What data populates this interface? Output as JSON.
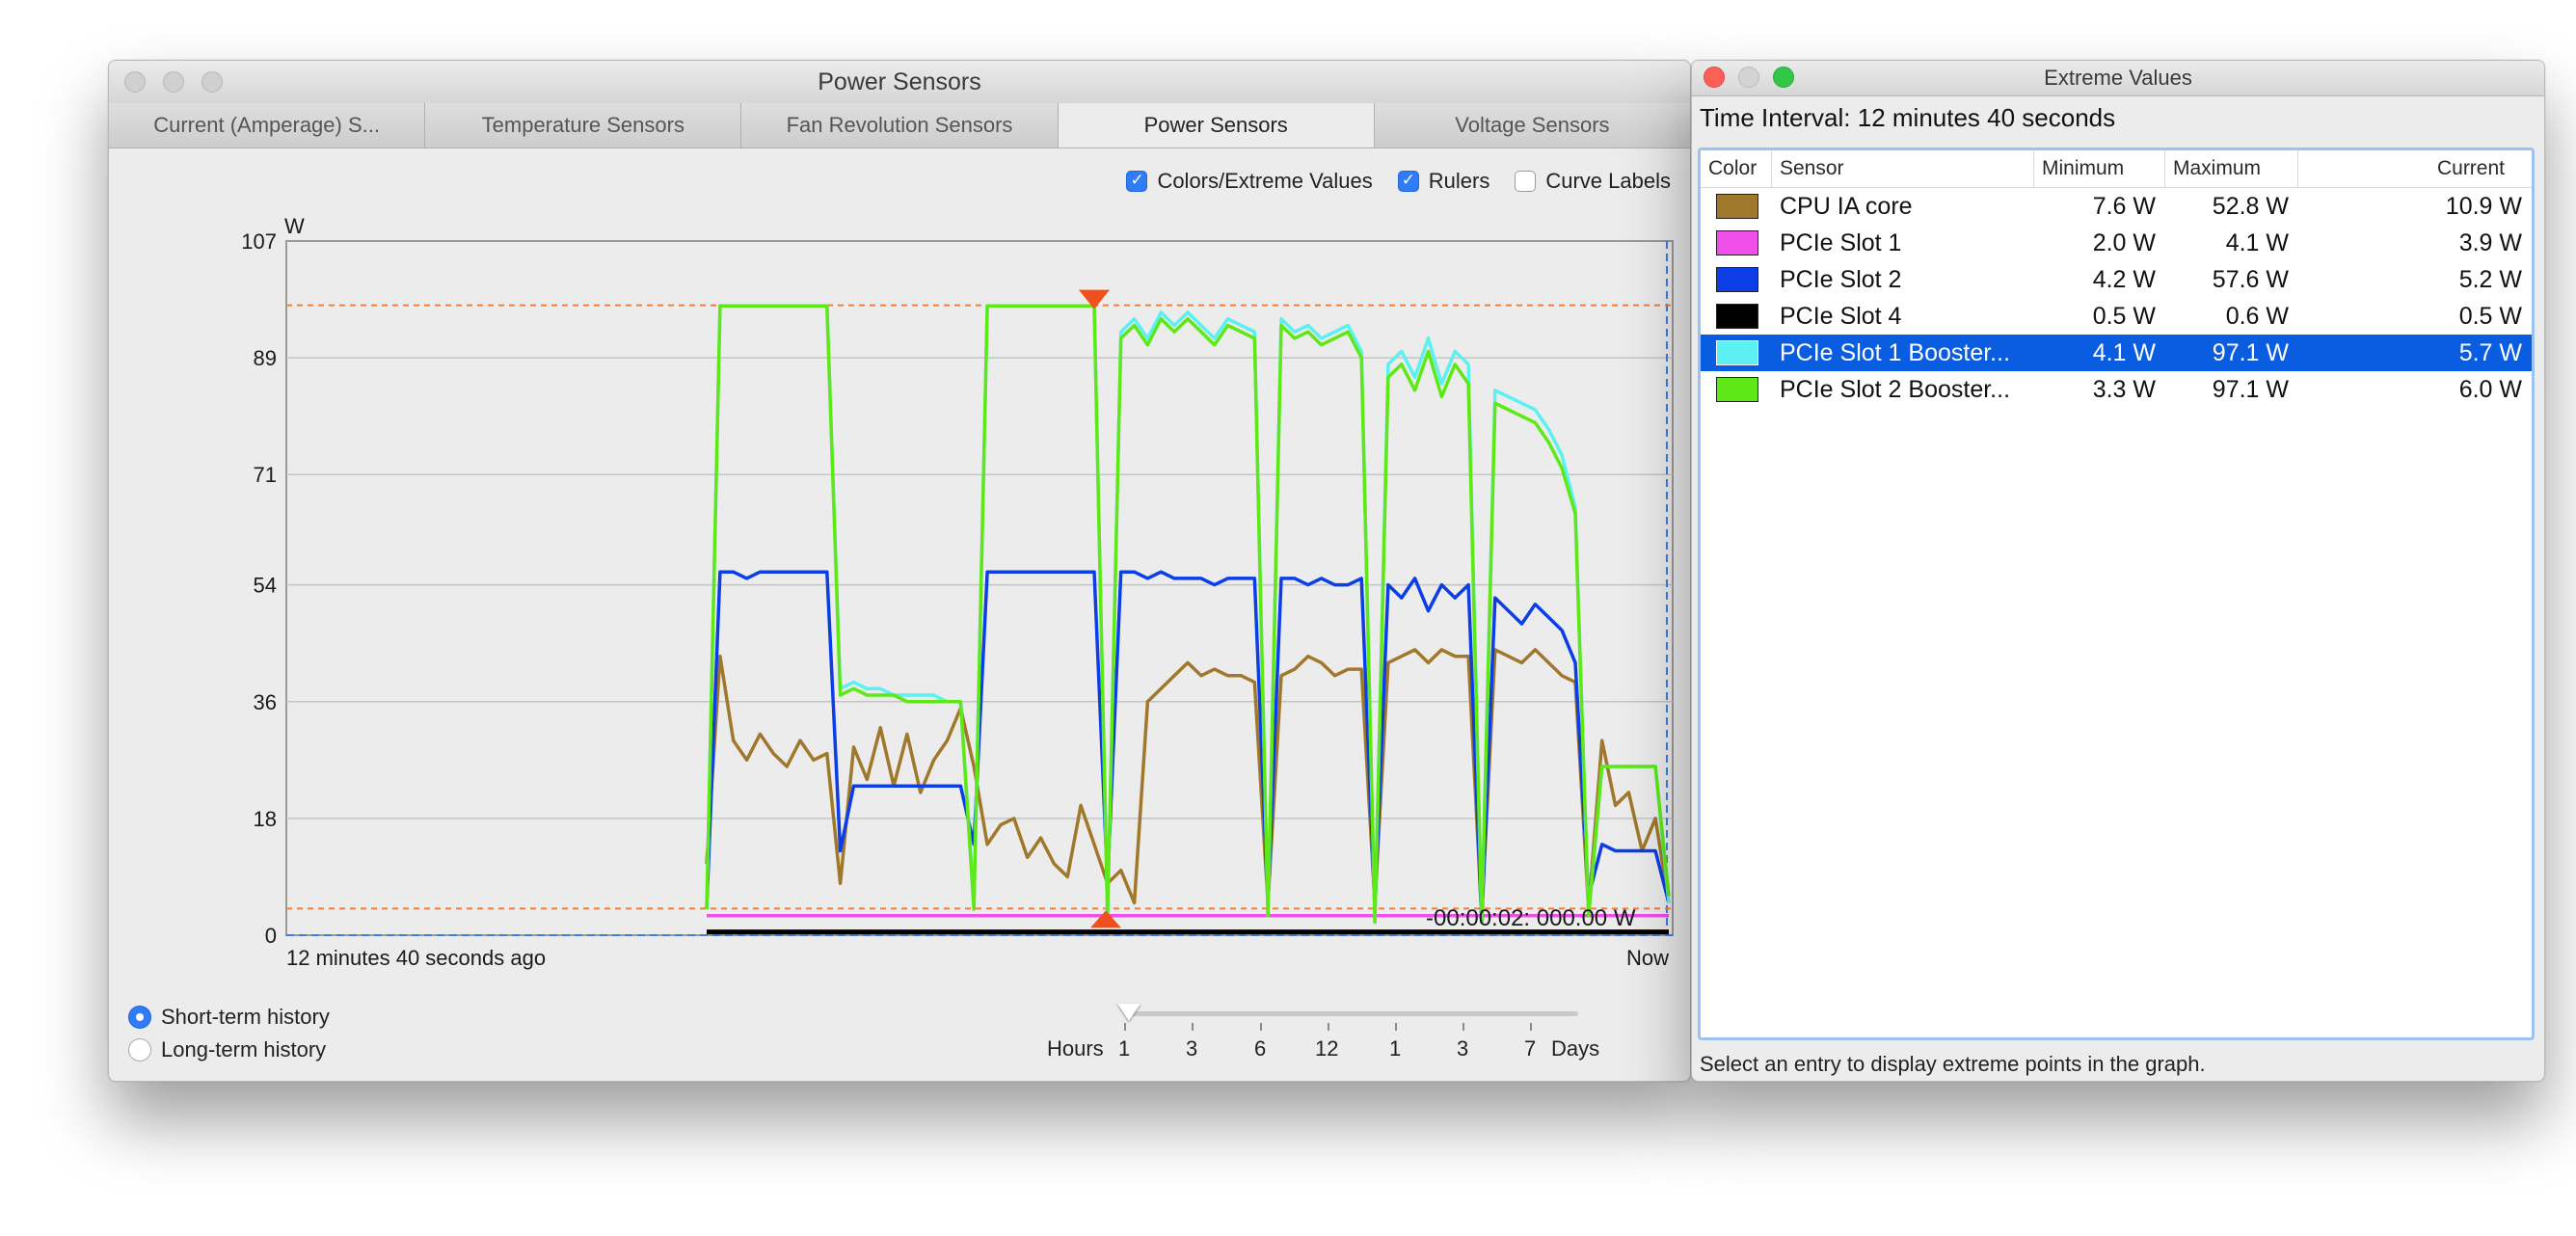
{
  "main_window": {
    "title": "Power Sensors",
    "tabs": [
      {
        "label": "Current (Amperage) S..."
      },
      {
        "label": "Temperature Sensors"
      },
      {
        "label": "Fan Revolution Sensors"
      },
      {
        "label": "Power Sensors",
        "active": true
      },
      {
        "label": "Voltage Sensors"
      }
    ],
    "options": {
      "colors_extreme": {
        "label": "Colors/Extreme Values",
        "checked": true
      },
      "rulers": {
        "label": "Rulers",
        "checked": true
      },
      "curve_labels": {
        "label": "Curve Labels",
        "checked": false
      }
    },
    "history": {
      "short_term": {
        "label": "Short-term history",
        "selected": true
      },
      "long_term": {
        "label": "Long-term history",
        "selected": false
      }
    },
    "slider": {
      "left_label": "Hours",
      "right_label": "Days",
      "ticks": [
        "1",
        "3",
        "6",
        "12",
        "1",
        "3",
        "7"
      ],
      "position": 0
    }
  },
  "chart_data": {
    "type": "line",
    "ylabel": "W",
    "yticks": [
      0,
      18,
      36,
      54,
      71,
      89,
      107
    ],
    "ylim": [
      0,
      107
    ],
    "x_start_label": "12 minutes 40 seconds ago",
    "x_end_label": "Now",
    "ruler_max": 97.1,
    "ruler_min": 4.1,
    "cursor_readout": "-00:00:02: 000.00 W",
    "grid": true,
    "series": [
      {
        "name": "CPU IA core",
        "color": "#a0782b",
        "values": [
          11,
          43,
          30,
          27,
          31,
          28,
          26,
          30,
          27,
          28,
          8,
          29,
          24,
          32,
          23,
          31,
          22,
          27,
          30,
          35,
          26,
          14,
          17,
          18,
          12,
          15,
          11,
          9,
          20,
          14,
          8,
          10,
          5,
          36,
          38,
          40,
          42,
          40,
          41,
          40,
          40,
          39,
          5,
          40,
          41,
          43,
          42,
          40,
          41,
          41,
          5,
          42,
          43,
          44,
          42,
          44,
          43,
          43,
          3,
          44,
          43,
          42,
          44,
          42,
          40,
          39,
          4,
          30,
          20,
          22,
          13,
          18,
          5
        ]
      },
      {
        "name": "PCIe Slot 1",
        "color": "#f04fe9",
        "values": [
          3,
          3,
          3,
          3,
          3,
          3,
          3,
          3,
          3,
          3,
          3,
          3,
          3,
          3,
          3,
          3,
          3,
          3,
          3,
          3,
          3,
          3,
          3,
          3,
          3,
          3,
          3,
          3,
          3,
          3,
          3,
          3,
          3,
          3,
          3,
          3,
          3,
          3,
          3,
          3,
          3,
          3,
          3,
          3,
          3,
          3,
          3,
          3,
          3,
          3,
          3,
          3,
          3,
          3,
          3,
          3,
          3,
          3,
          3,
          3,
          3,
          3,
          3,
          3,
          3,
          3,
          3,
          3,
          3,
          3,
          3,
          3,
          3
        ]
      },
      {
        "name": "PCIe Slot 2",
        "color": "#0b3ee6",
        "values": [
          4,
          56,
          56,
          55,
          56,
          56,
          56,
          56,
          56,
          56,
          13,
          23,
          23,
          23,
          23,
          23,
          23,
          23,
          23,
          23,
          14,
          56,
          56,
          56,
          56,
          56,
          56,
          56,
          56,
          56,
          8,
          56,
          56,
          55,
          56,
          55,
          55,
          55,
          54,
          55,
          55,
          55,
          5,
          55,
          55,
          54,
          55,
          54,
          54,
          55,
          4,
          54,
          52,
          55,
          50,
          54,
          52,
          54,
          2,
          52,
          50,
          48,
          51,
          49,
          47,
          42,
          6,
          14,
          13,
          13,
          13,
          13,
          5
        ]
      },
      {
        "name": "PCIe Slot 4",
        "color": "#000000",
        "values": [
          0.5,
          0.5,
          0.5,
          0.5,
          0.5,
          0.5,
          0.5,
          0.5,
          0.5,
          0.5,
          0.5,
          0.5,
          0.5,
          0.5,
          0.5,
          0.5,
          0.5,
          0.5,
          0.5,
          0.5,
          0.5,
          0.5,
          0.5,
          0.5,
          0.5,
          0.5,
          0.5,
          0.5,
          0.5,
          0.5,
          0.5,
          0.5,
          0.5,
          0.5,
          0.5,
          0.5,
          0.5,
          0.5,
          0.5,
          0.5,
          0.5,
          0.5,
          0.5,
          0.5,
          0.5,
          0.5,
          0.5,
          0.5,
          0.5,
          0.5,
          0.5,
          0.5,
          0.5,
          0.5,
          0.5,
          0.5,
          0.5,
          0.5,
          0.5,
          0.5,
          0.5,
          0.5,
          0.5,
          0.5,
          0.5,
          0.5,
          0.5,
          0.5,
          0.5,
          0.5,
          0.5,
          0.5,
          0.5
        ]
      },
      {
        "name": "PCIe Slot 1 Booster...",
        "color": "#5cf0f2",
        "values": [
          4,
          97,
          97,
          97,
          97,
          97,
          97,
          97,
          97,
          97,
          38,
          39,
          38,
          38,
          37,
          37,
          37,
          37,
          36,
          36,
          5,
          97,
          97,
          97,
          97,
          97,
          97,
          97,
          97,
          97,
          3,
          93,
          95,
          92,
          96,
          94,
          96,
          94,
          92,
          95,
          94,
          93,
          3,
          95,
          93,
          94,
          92,
          93,
          94,
          90,
          2,
          88,
          90,
          86,
          92,
          85,
          90,
          88,
          2,
          84,
          83,
          82,
          81,
          78,
          74,
          66,
          3,
          26,
          26,
          26,
          26,
          26,
          5
        ]
      },
      {
        "name": "PCIe Slot 2 Booster...",
        "color": "#5ee818",
        "values": [
          4,
          97,
          97,
          97,
          97,
          97,
          97,
          97,
          97,
          97,
          37,
          38,
          37,
          37,
          37,
          36,
          36,
          36,
          36,
          36,
          4,
          97,
          97,
          97,
          97,
          97,
          97,
          97,
          97,
          97,
          3,
          92,
          94,
          91,
          95,
          93,
          95,
          93,
          91,
          94,
          93,
          92,
          3,
          94,
          92,
          93,
          91,
          92,
          93,
          89,
          2,
          86,
          88,
          84,
          90,
          83,
          88,
          85,
          2,
          82,
          81,
          80,
          79,
          76,
          72,
          65,
          3,
          26,
          26,
          26,
          26,
          26,
          6
        ]
      }
    ]
  },
  "extreme_window": {
    "title": "Extreme Values",
    "interval": "Time Interval: 12 minutes 40 seconds",
    "columns": {
      "color": "Color",
      "sensor": "Sensor",
      "min": "Minimum",
      "max": "Maximum",
      "current": "Current"
    },
    "rows": [
      {
        "color": "#a0782b",
        "sensor": "CPU IA core",
        "min": "7.6 W",
        "max": "52.8 W",
        "current": "10.9 W"
      },
      {
        "color": "#f04fe9",
        "sensor": "PCIe Slot 1",
        "min": "2.0 W",
        "max": "4.1 W",
        "current": "3.9 W"
      },
      {
        "color": "#0b3ee6",
        "sensor": "PCIe Slot 2",
        "min": "4.2 W",
        "max": "57.6 W",
        "current": "5.2 W"
      },
      {
        "color": "#000000",
        "sensor": "PCIe Slot 4",
        "min": "0.5 W",
        "max": "0.6 W",
        "current": "0.5 W"
      },
      {
        "color": "#5cf0f2",
        "sensor": "PCIe Slot 1 Booster...",
        "min": "4.1 W",
        "max": "97.1 W",
        "current": "5.7 W",
        "selected": true
      },
      {
        "color": "#5ee818",
        "sensor": "PCIe Slot 2 Booster...",
        "min": "3.3 W",
        "max": "97.1 W",
        "current": "6.0 W"
      }
    ],
    "footnote": "Select an entry to display extreme points in the graph."
  }
}
